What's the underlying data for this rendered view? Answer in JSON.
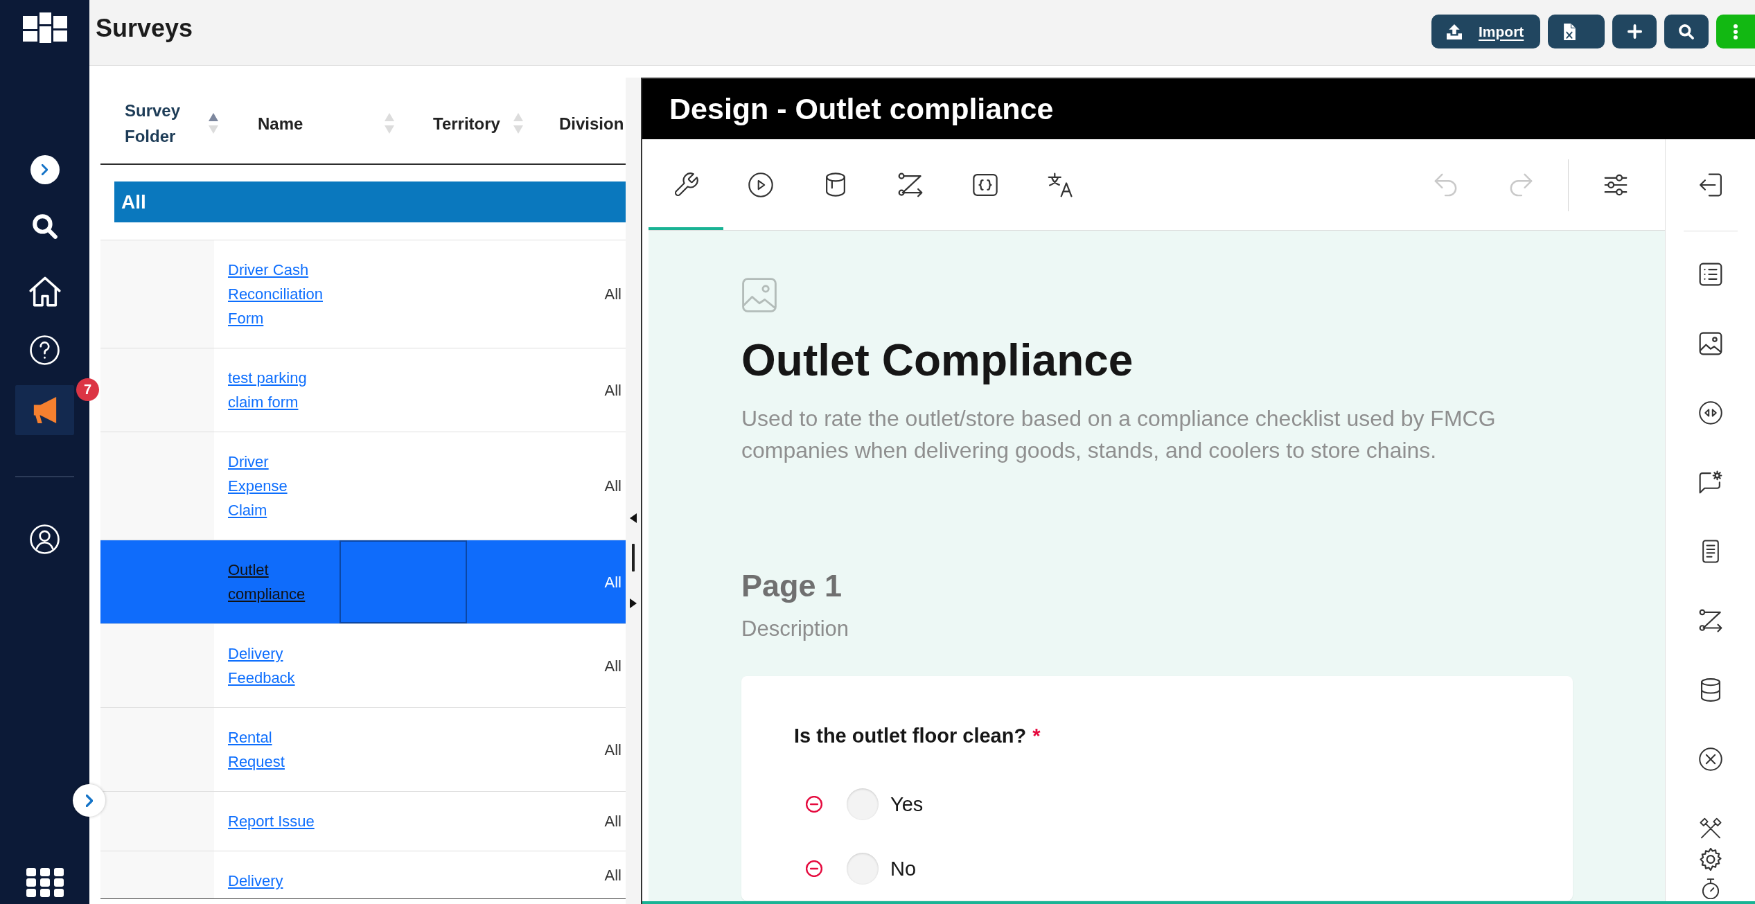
{
  "sidebar": {
    "items": [
      {
        "selected": false
      },
      {
        "selected": false
      },
      {
        "selected": false
      },
      {
        "selected": true,
        "badge": "7"
      },
      {
        "selected": false
      }
    ]
  },
  "header": {
    "title": "Surveys",
    "buttons": [
      {
        "kind": "import",
        "label": "Import"
      },
      {
        "kind": "excel"
      },
      {
        "kind": "add"
      },
      {
        "kind": "search"
      },
      {
        "kind": "more"
      }
    ]
  },
  "table": {
    "columns": [
      {
        "label": "Survey Folder",
        "sortable": true,
        "sorted": true
      },
      {
        "label": "Name",
        "sortable": true,
        "sorted": false
      },
      {
        "label": "Territory",
        "sortable": true,
        "sorted": false
      },
      {
        "label": "Division"
      }
    ],
    "group": {
      "label": "All"
    },
    "rows": [
      {
        "name": "Driver Cash Reconciliation Form",
        "division": "All",
        "selected": false
      },
      {
        "name": "test parking claim form",
        "division": "All",
        "selected": false
      },
      {
        "name": "Driver Expense Claim",
        "division": "All",
        "selected": false
      },
      {
        "name": "Outlet compliance",
        "division": "All",
        "selected": true
      },
      {
        "name": "Delivery Feedback",
        "division": "All",
        "selected": false
      },
      {
        "name": "Rental Request",
        "division": "All",
        "selected": false
      },
      {
        "name": "Report Issue",
        "division": "All",
        "selected": false
      },
      {
        "name": "Delivery",
        "division": "All",
        "selected": false
      }
    ]
  },
  "designer": {
    "title": "Design - Outlet compliance",
    "tabs": [
      {
        "selected": true
      },
      {
        "selected": false
      },
      {
        "selected": false
      },
      {
        "selected": false
      },
      {
        "selected": false
      },
      {
        "selected": false
      }
    ],
    "undo": {
      "disabled": true
    },
    "redo": {
      "disabled": true
    },
    "survey": {
      "title": "Outlet Compliance",
      "description": "Used to rate the outlet/store based on a compliance checklist used by FMCG companies when delivering goods, stands, and coolers to store chains.",
      "page": {
        "title": "Page 1",
        "description": "Description"
      },
      "question": {
        "title": "Is the outlet floor clean?",
        "required_mark": "*",
        "choices": [
          {
            "label": "Yes",
            "selected": false
          },
          {
            "label": "No",
            "selected": false
          }
        ]
      }
    }
  }
}
